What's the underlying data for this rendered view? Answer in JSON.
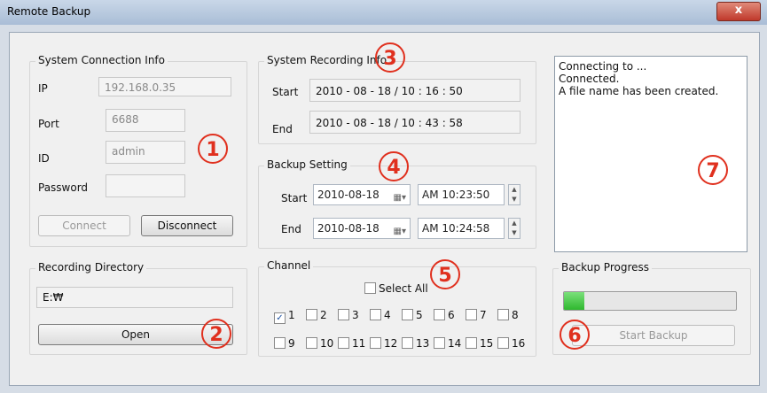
{
  "window": {
    "title": "Remote Backup",
    "close_glyph": "x"
  },
  "system_connection": {
    "group_label": "System Connection Info",
    "ip_label": "IP",
    "ip_value": "192.168.0.35",
    "port_label": "Port",
    "port_value": "6688",
    "id_label": "ID",
    "id_value": "admin",
    "password_label": "Password",
    "password_value": "",
    "connect_label": "Connect",
    "disconnect_label": "Disconnect"
  },
  "recording_directory": {
    "group_label": "Recording Directory",
    "path": "E:₩",
    "open_label": "Open"
  },
  "system_recording": {
    "group_label": "System Recording Info",
    "start_label": "Start",
    "start_value": "2010 - 08 - 18  /  10 : 16 : 50",
    "end_label": "End",
    "end_value": "2010 - 08 - 18  /  10 : 43 : 58"
  },
  "backup_setting": {
    "group_label": "Backup Setting",
    "start_label": "Start",
    "start_date": "2010-08-18",
    "start_time": "AM 10:23:50",
    "end_label": "End",
    "end_date": "2010-08-18",
    "end_time": "AM 10:24:58"
  },
  "channel": {
    "group_label": "Channel",
    "select_all_label": "Select All",
    "row1": [
      {
        "label": "1",
        "checked": true
      },
      {
        "label": "2",
        "checked": false
      },
      {
        "label": "3",
        "checked": false
      },
      {
        "label": "4",
        "checked": false
      },
      {
        "label": "5",
        "checked": false
      },
      {
        "label": "6",
        "checked": false
      },
      {
        "label": "7",
        "checked": false
      },
      {
        "label": "8",
        "checked": false
      }
    ],
    "row2": [
      {
        "label": "9",
        "checked": false
      },
      {
        "label": "10",
        "checked": false
      },
      {
        "label": "11",
        "checked": false
      },
      {
        "label": "12",
        "checked": false
      },
      {
        "label": "13",
        "checked": false
      },
      {
        "label": "14",
        "checked": false
      },
      {
        "label": "15",
        "checked": false
      },
      {
        "label": "16",
        "checked": false
      }
    ]
  },
  "log": {
    "lines": [
      "Connecting to ...",
      "Connected.",
      "A file name has been created."
    ]
  },
  "backup_progress": {
    "group_label": "Backup Progress",
    "progress_fraction": 0.12,
    "start_label": "Start Backup"
  },
  "callouts": [
    "1",
    "2",
    "3",
    "4",
    "5",
    "6",
    "7"
  ],
  "colors": {
    "callout": "#e0301e",
    "progress_fill": "#2eb82e"
  }
}
